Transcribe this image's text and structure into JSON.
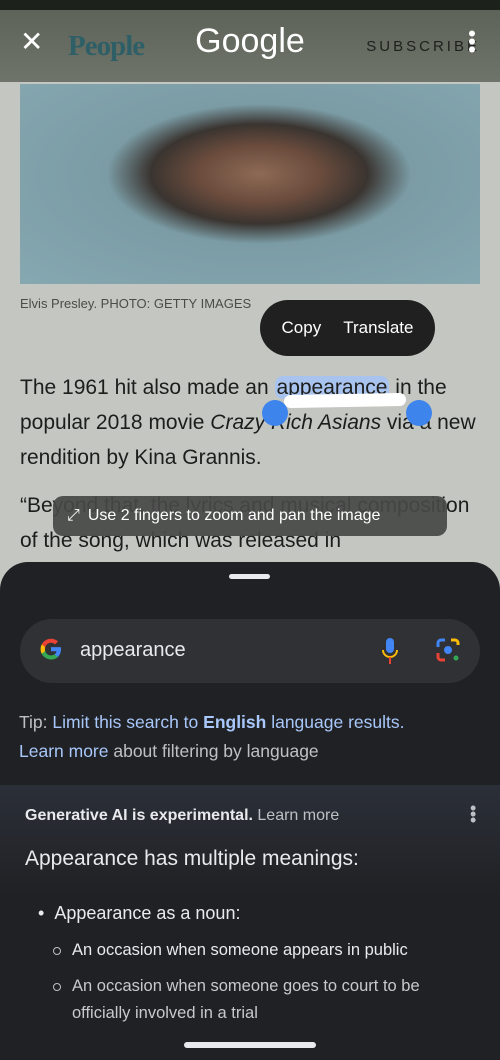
{
  "header": {
    "close_icon": "close-icon",
    "site_logo": "People",
    "google_logo": "Google",
    "subscribe": "SUBSCRIBE",
    "menu_icon": "more-vert-icon"
  },
  "article": {
    "caption": "Elvis Presley. PHOTO: GETTY IMAGES",
    "p1_before": "The 1961 hit also made an ",
    "p1_selected": "appearance",
    "p1_after1": " in the popular 2018 movie ",
    "p1_italic": "Crazy Rich Asians",
    "p1_after2": " via a new rendition by Kina Grannis.",
    "p2": "“Beyond that, the lyrics and musical composition of the song, which was released in"
  },
  "selection_popup": {
    "copy": "Copy",
    "translate": "Translate"
  },
  "toast": {
    "icon": "pinch-zoom-icon",
    "text": "Use 2 fingers to zoom and pan the image"
  },
  "search": {
    "query": "appearance",
    "mic_icon": "mic-icon",
    "lens_icon": "lens-icon"
  },
  "tip": {
    "prefix": "Tip: ",
    "link1": "Limit this search to ",
    "bold": "English",
    "link1_end": " language results.",
    "link2": "Learn more",
    "suffix": " about filtering by language"
  },
  "ai": {
    "notice": "Generative AI is experimental.",
    "learn_more": "Learn more",
    "title": "Appearance has multiple meanings:",
    "bullet": "Appearance as a noun:",
    "subitems": [
      "An occasion when someone appears in public",
      "An occasion when someone goes to court to be officially involved in a trial"
    ]
  },
  "colors": {
    "link": "#a8c7fa",
    "selection": "#a9c3ef",
    "handle": "#3d84ec",
    "sheet": "#202124"
  }
}
